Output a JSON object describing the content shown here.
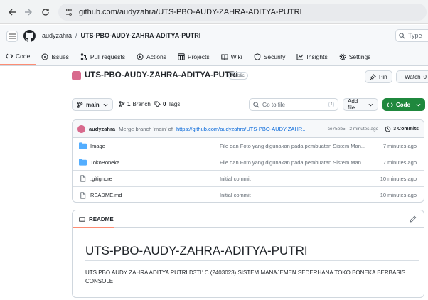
{
  "browser": {
    "url": "github.com/audyzahra/UTS-PBO-AUDY-ZAHRA-ADITYA-PUTRI"
  },
  "header": {
    "owner": "audyzahra",
    "separator": "/",
    "repo": "UTS-PBO-AUDY-ZAHRA-ADITYA-PUTRI",
    "search_placeholder": "Type"
  },
  "tabs": [
    {
      "label": "Code",
      "icon": "code-icon"
    },
    {
      "label": "Issues",
      "icon": "issue-icon"
    },
    {
      "label": "Pull requests",
      "icon": "pull-request-icon"
    },
    {
      "label": "Actions",
      "icon": "actions-icon"
    },
    {
      "label": "Projects",
      "icon": "projects-icon"
    },
    {
      "label": "Wiki",
      "icon": "wiki-icon"
    },
    {
      "label": "Security",
      "icon": "shield-icon"
    },
    {
      "label": "Insights",
      "icon": "insights-icon"
    },
    {
      "label": "Settings",
      "icon": "gear-icon"
    }
  ],
  "repo": {
    "title": "UTS-PBO-AUDY-ZAHRA-ADITYA-PUTRI",
    "visibility": "Public",
    "pin_label": "Pin",
    "watch_label": "Watch",
    "watch_count": "0"
  },
  "toolbar": {
    "branch": "main",
    "branch_count": "1",
    "branch_label": "Branch",
    "tag_count": "0",
    "tag_label": "Tags",
    "goto_placeholder": "Go to file",
    "goto_kbd": "t",
    "add_file_label": "Add file",
    "code_label": "Code"
  },
  "latest_commit": {
    "author": "audyzahra",
    "message": "Merge branch 'main' of",
    "link": "https://github.com/audyzahra/UTS-PBO-AUDY-ZAHR...",
    "hash_time": "ce75eb5 · 2 minutes ago",
    "commits": "3 Commits"
  },
  "files": [
    {
      "name": "Image",
      "type": "folder",
      "message": "File dan Foto yang digunakan pada pembuatan Sistem Man...",
      "date": "7 minutes ago"
    },
    {
      "name": "TokoBoneka",
      "type": "folder",
      "message": "File dan Foto yang digunakan pada pembuatan Sistem Man...",
      "date": "7 minutes ago"
    },
    {
      "name": ".gitignore",
      "type": "file",
      "message": "Initial commit",
      "date": "10 minutes ago"
    },
    {
      "name": "README.md",
      "type": "file",
      "message": "Initial commit",
      "date": "10 minutes ago"
    }
  ],
  "readme": {
    "tab_label": "README",
    "title": "UTS-PBO-AUDY-ZAHRA-ADITYA-PUTRI",
    "body": "UTS PBO AUDY ZAHRA ADITYA PUTRI D3TI1C (2403023) SISTEM MANAJEMEN SEDERHANA TOKO BONEKA BERBASIS CONSOLE"
  },
  "colors": {
    "accent_tab": "#fd8c73",
    "code_button": "#1f883d",
    "link": "#0969da",
    "folder": "#54aeff"
  }
}
